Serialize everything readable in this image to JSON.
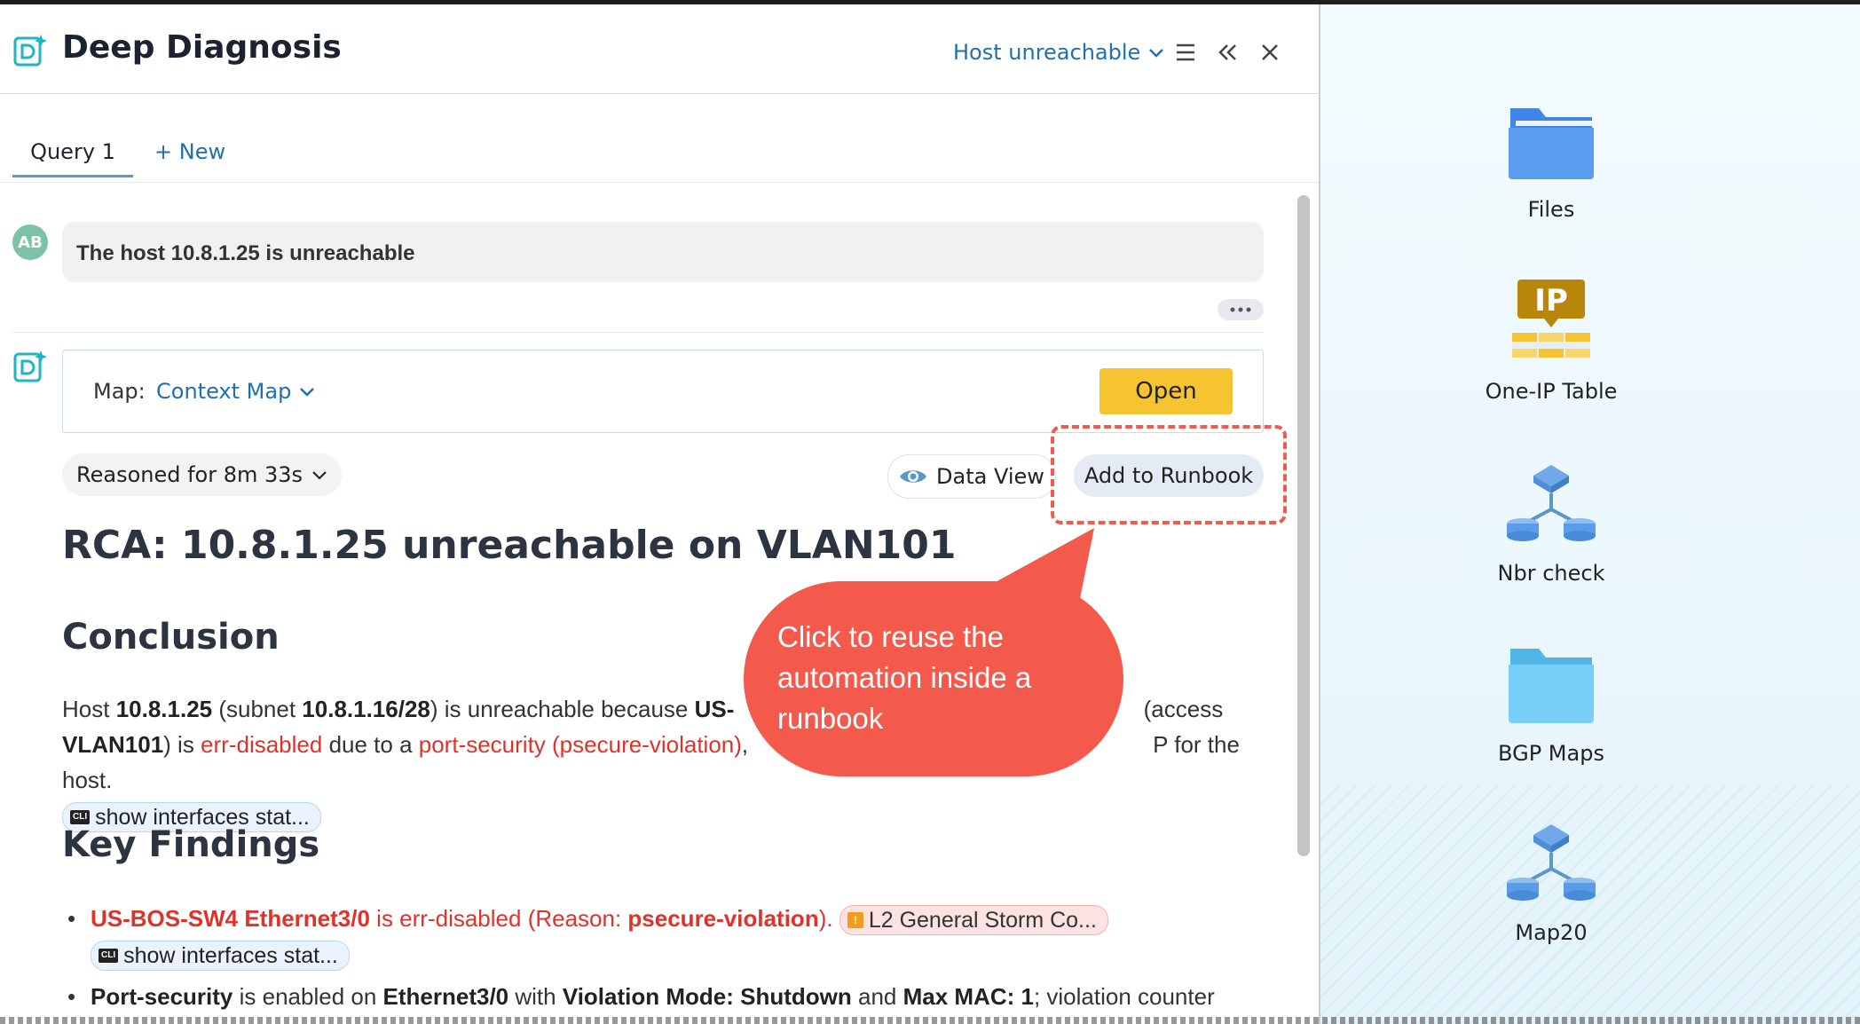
{
  "header": {
    "title": "Deep Diagnosis",
    "scenario": "Host unreachable"
  },
  "tabs": [
    {
      "label": "Query 1",
      "active": true
    },
    {
      "label": "+ New",
      "active": false
    }
  ],
  "user": {
    "initials": "AB",
    "query": "The host 10.8.1.25 is unreachable"
  },
  "map": {
    "label": "Map:",
    "value": "Context Map",
    "open_label": "Open"
  },
  "reasoning": "Reasoned for 8m 33s",
  "actions": {
    "data_view": "Data View",
    "add_runbook": "Add to Runbook"
  },
  "rca_title": "RCA: 10.8.1.25 unreachable on VLAN101",
  "conclusion": {
    "heading": "Conclusion",
    "t1": "Host ",
    "host": "10.8.1.25",
    "t2": " (subnet ",
    "subnet": "10.8.1.16/28",
    "t3": ") is unreachable because ",
    "sw": "US-",
    "t4": " (access",
    "vlan": "VLAN101",
    "t5": ") is ",
    "errdis": "err-disabled",
    "t6": " due to a ",
    "portsec": "port-security (psecure-violation)",
    "t7": ",",
    "t8": "P for the host.",
    "cli_chip": "show interfaces stat..."
  },
  "findings": {
    "heading": "Key Findings",
    "f1_red": "US-BOS-SW4 Ethernet3/0",
    "f1_t": " is err-disabled (Reason: ",
    "f1_bold": "psecure-violation",
    "f1_end": ").",
    "f1_chip": "L2 General Storm Co...",
    "f1_cli": "show interfaces stat...",
    "f2_b1": "Port-security",
    "f2_t1": " is enabled on ",
    "f2_b2": "Ethernet3/0",
    "f2_t2": " with ",
    "f2_b3": "Violation Mode: Shutdown",
    "f2_t3": " and ",
    "f2_b4": "Max MAC: 1",
    "f2_t4": "; violation counter"
  },
  "callout": "Click to reuse the automation inside a runbook",
  "desktop": [
    {
      "label": "Files",
      "icon": "folder-icon"
    },
    {
      "label": "One-IP Table",
      "icon": "ip-table-icon"
    },
    {
      "label": "Nbr check",
      "icon": "topology-icon"
    },
    {
      "label": "BGP Maps",
      "icon": "folder-icon"
    },
    {
      "label": "Map20",
      "icon": "topology-icon"
    }
  ],
  "colors": {
    "accent": "#1f6fb2",
    "open_button": "#f6c430",
    "callout": "#f45a4c",
    "error_text": "#e0312b"
  }
}
